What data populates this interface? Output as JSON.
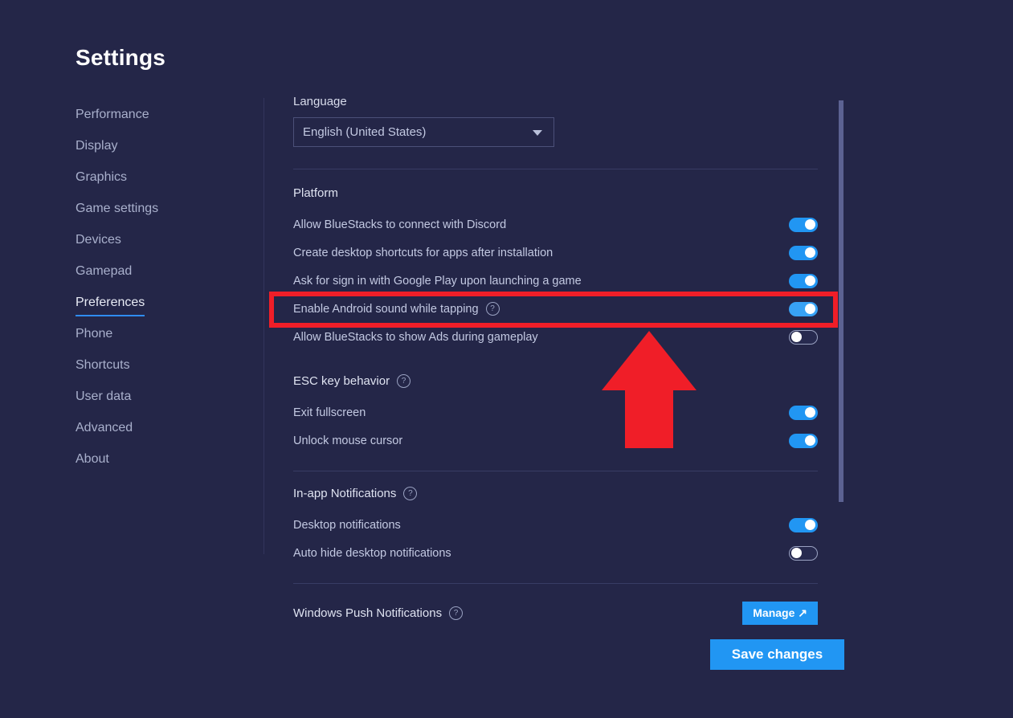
{
  "page": {
    "title": "Settings"
  },
  "sidebar": {
    "items": [
      {
        "label": "Performance",
        "active": false
      },
      {
        "label": "Display",
        "active": false
      },
      {
        "label": "Graphics",
        "active": false
      },
      {
        "label": "Game settings",
        "active": false
      },
      {
        "label": "Devices",
        "active": false
      },
      {
        "label": "Gamepad",
        "active": false
      },
      {
        "label": "Preferences",
        "active": true
      },
      {
        "label": "Phone",
        "active": false
      },
      {
        "label": "Shortcuts",
        "active": false
      },
      {
        "label": "User data",
        "active": false
      },
      {
        "label": "Advanced",
        "active": false
      },
      {
        "label": "About",
        "active": false
      }
    ]
  },
  "language": {
    "label": "Language",
    "selected": "English (United States)",
    "caret_icon": "chevron-down-icon"
  },
  "platform": {
    "heading": "Platform",
    "rows": [
      {
        "label": "Allow BlueStacks to connect with Discord",
        "state": "on",
        "help": false
      },
      {
        "label": "Create desktop shortcuts for apps after installation",
        "state": "on",
        "help": false
      },
      {
        "label": "Ask for sign in with Google Play upon launching a game",
        "state": "on",
        "help": false
      },
      {
        "label": "Enable Android sound while tapping",
        "state": "on",
        "help": true
      },
      {
        "label": "Allow BlueStacks to show Ads during gameplay",
        "state": "off",
        "help": false
      }
    ]
  },
  "esc_key": {
    "heading": "ESC key behavior",
    "help": true,
    "rows": [
      {
        "label": "Exit fullscreen",
        "state": "on"
      },
      {
        "label": "Unlock mouse cursor",
        "state": "on"
      }
    ]
  },
  "in_app_notifications": {
    "heading": "In-app Notifications",
    "help": true,
    "rows": [
      {
        "label": "Desktop notifications",
        "state": "on"
      },
      {
        "label": "Auto hide desktop notifications",
        "state": "off"
      }
    ]
  },
  "windows_push": {
    "heading": "Windows Push Notifications",
    "help": true,
    "manage_label": "Manage ↗"
  },
  "footer": {
    "save_label": "Save changes"
  },
  "icons": {
    "help": "?",
    "help_icon_name": "help-circle-icon"
  },
  "colors": {
    "background": "#242648",
    "accent": "#2196f3",
    "annotation_red": "#f01e28",
    "text_primary": "#dfe3f1",
    "text_secondary": "#c3c9e2",
    "divider": "#383c64"
  },
  "annotations": {
    "highlight_target": "Enable Android sound while tapping",
    "arrow_direction": "up"
  }
}
